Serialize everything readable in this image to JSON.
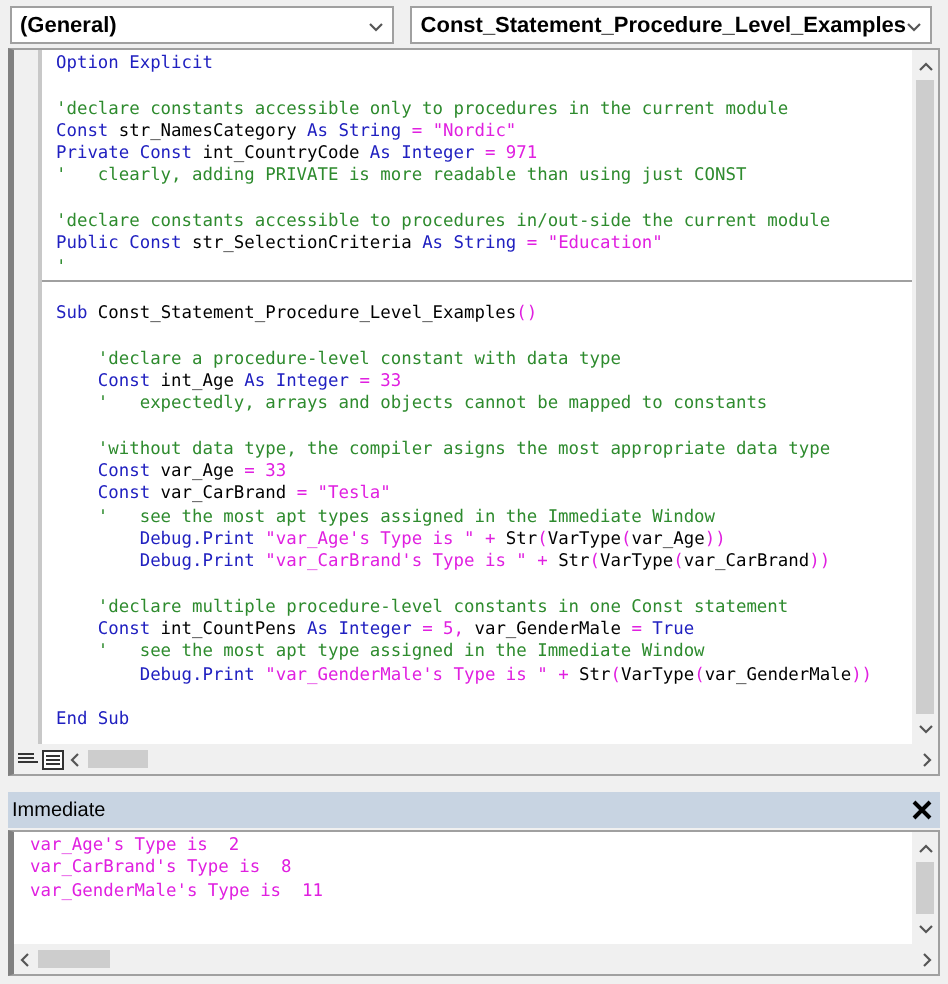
{
  "toolbar": {
    "object_box": {
      "value": "(General)"
    },
    "procedure_box": {
      "value": "Const_Statement_Procedure_Level_Examples"
    }
  },
  "code_window": {
    "sections": [
      {
        "blocks": [
          [
            [
              {
                "kind": "keyword",
                "text": "Option Explicit"
              }
            ]
          ],
          [
            [
              {
                "kind": "comment",
                "text": "'declare constants accessible only to procedures in the current module"
              }
            ],
            [
              {
                "kind": "keyword",
                "text": "Const"
              },
              {
                "kind": "plain",
                "text": " str_NamesCategory "
              },
              {
                "kind": "keyword",
                "text": "As String"
              },
              {
                "kind": "literal",
                "text": " = \"Nordic\""
              }
            ],
            [
              {
                "kind": "keyword",
                "text": "Private Const"
              },
              {
                "kind": "plain",
                "text": " int_CountryCode "
              },
              {
                "kind": "keyword",
                "text": "As Integer"
              },
              {
                "kind": "literal",
                "text": " = 971"
              }
            ],
            [
              {
                "kind": "comment",
                "text": "'   clearly, adding PRIVATE is more readable than using just CONST"
              }
            ]
          ],
          [
            [
              {
                "kind": "comment",
                "text": "'declare constants accessible to procedures in/out-side the current module"
              }
            ],
            [
              {
                "kind": "keyword",
                "text": "Public Const"
              },
              {
                "kind": "plain",
                "text": " str_SelectionCriteria "
              },
              {
                "kind": "keyword",
                "text": "As String"
              },
              {
                "kind": "literal",
                "text": " = \"Education\""
              }
            ],
            [
              {
                "kind": "comment",
                "text": "'"
              }
            ]
          ]
        ]
      },
      {
        "blocks": [
          [
            [
              {
                "kind": "keyword",
                "text": "Sub"
              },
              {
                "kind": "plain",
                "text": " Const_Statement_Procedure_Level_Examples"
              },
              {
                "kind": "literal",
                "text": "()"
              }
            ]
          ],
          [
            [
              {
                "kind": "comment",
                "text": "    'declare a procedure-level constant with data type"
              }
            ],
            [
              {
                "kind": "keyword",
                "text": "    Const"
              },
              {
                "kind": "plain",
                "text": " int_Age "
              },
              {
                "kind": "keyword",
                "text": "As Integer"
              },
              {
                "kind": "literal",
                "text": " = 33"
              }
            ],
            [
              {
                "kind": "comment",
                "text": "    '   expectedly, arrays and objects cannot be mapped to constants"
              }
            ]
          ],
          [
            [
              {
                "kind": "comment",
                "text": "    'without data type, the compiler asigns the most appropriate data type"
              }
            ],
            [
              {
                "kind": "keyword",
                "text": "    Const"
              },
              {
                "kind": "plain",
                "text": " var_Age "
              },
              {
                "kind": "literal",
                "text": "= 33"
              }
            ],
            [
              {
                "kind": "keyword",
                "text": "    Const"
              },
              {
                "kind": "plain",
                "text": " var_CarBrand "
              },
              {
                "kind": "literal",
                "text": "= \"Tesla\""
              }
            ],
            [
              {
                "kind": "comment",
                "text": "    '   see the most apt types assigned in the Immediate Window"
              }
            ],
            [
              {
                "kind": "keyword",
                "text": "        Debug.Print"
              },
              {
                "kind": "literal",
                "text": " \"var_Age's Type is \" +"
              },
              {
                "kind": "plain",
                "text": " Str"
              },
              {
                "kind": "literal",
                "text": "("
              },
              {
                "kind": "plain",
                "text": "VarType"
              },
              {
                "kind": "literal",
                "text": "("
              },
              {
                "kind": "plain",
                "text": "var_Age"
              },
              {
                "kind": "literal",
                "text": "))"
              }
            ],
            [
              {
                "kind": "keyword",
                "text": "        Debug.Print"
              },
              {
                "kind": "literal",
                "text": " \"var_CarBrand's Type is \" +"
              },
              {
                "kind": "plain",
                "text": " Str"
              },
              {
                "kind": "literal",
                "text": "("
              },
              {
                "kind": "plain",
                "text": "VarType"
              },
              {
                "kind": "literal",
                "text": "("
              },
              {
                "kind": "plain",
                "text": "var_CarBrand"
              },
              {
                "kind": "literal",
                "text": "))"
              }
            ]
          ],
          [
            [
              {
                "kind": "comment",
                "text": "    'declare multiple procedure-level constants in one Const statement"
              }
            ],
            [
              {
                "kind": "keyword",
                "text": "    Const"
              },
              {
                "kind": "plain",
                "text": " int_CountPens "
              },
              {
                "kind": "keyword",
                "text": "As Integer"
              },
              {
                "kind": "literal",
                "text": " = 5,"
              },
              {
                "kind": "plain",
                "text": " var_GenderMale "
              },
              {
                "kind": "literal",
                "text": "="
              },
              {
                "kind": "keyword",
                "text": " True"
              }
            ],
            [
              {
                "kind": "comment",
                "text": "    '   see the most apt type assigned in the Immediate Window"
              }
            ],
            [
              {
                "kind": "keyword",
                "text": "        Debug.Print"
              },
              {
                "kind": "literal",
                "text": " \"var_GenderMale's Type is \" +"
              },
              {
                "kind": "plain",
                "text": " Str"
              },
              {
                "kind": "literal",
                "text": "("
              },
              {
                "kind": "plain",
                "text": "VarType"
              },
              {
                "kind": "literal",
                "text": "("
              },
              {
                "kind": "plain",
                "text": "var_GenderMale"
              },
              {
                "kind": "literal",
                "text": "))"
              }
            ]
          ],
          [
            [
              {
                "kind": "keyword",
                "text": "End Sub"
              }
            ]
          ]
        ]
      }
    ]
  },
  "immediate_window": {
    "title": "Immediate",
    "lines": [
      "var_Age's Type is  2",
      "var_CarBrand's Type is  8",
      "var_GenderMale's Type is  11"
    ]
  }
}
